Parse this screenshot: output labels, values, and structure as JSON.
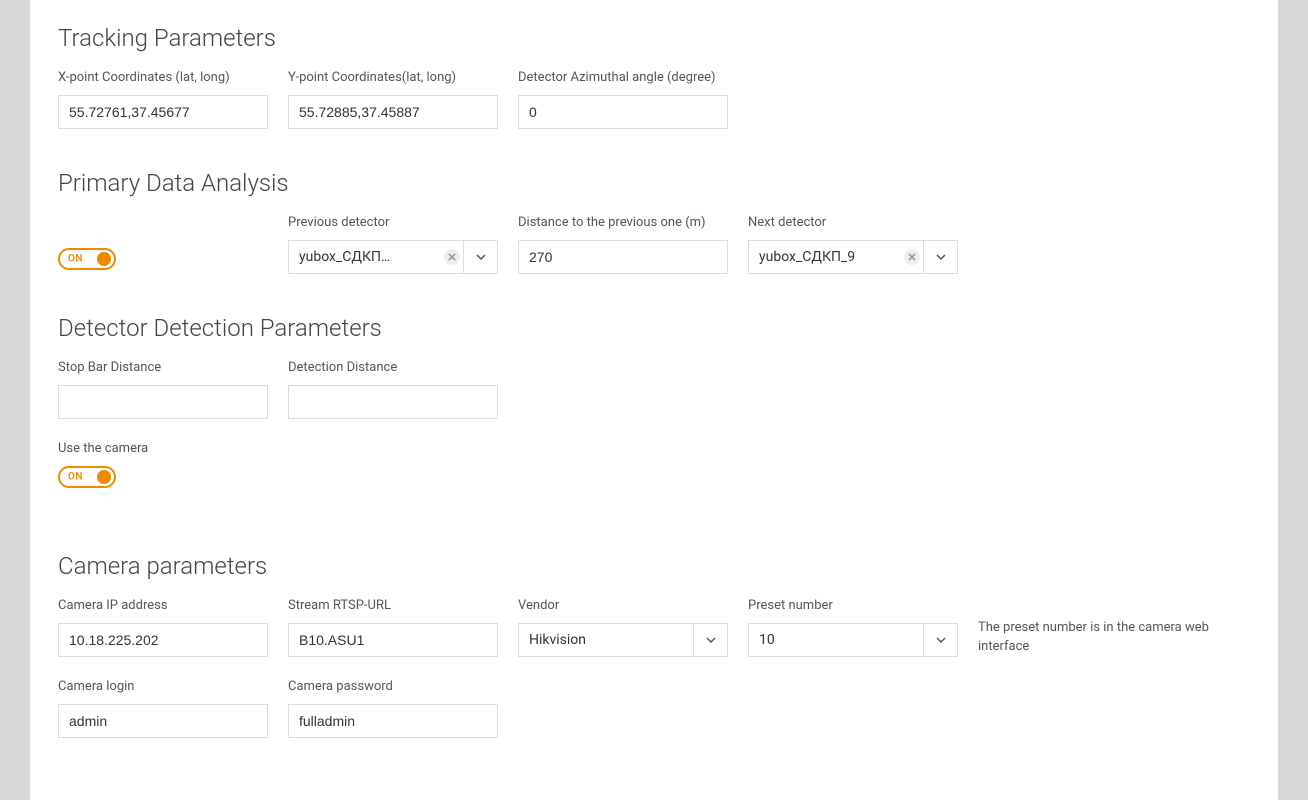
{
  "sections": {
    "tracking": {
      "title": "Tracking Parameters",
      "x_label": "X-point Coordinates (lat, long)",
      "x_value": "55.72761,37.45677",
      "y_label": "Y-point Coordinates(lat, long)",
      "y_value": "55.72885,37.45887",
      "azimuth_label": "Detector Azimuthal angle (degree)",
      "azimuth_value": "0"
    },
    "primary": {
      "title": "Primary Data Analysis",
      "toggle_label": "ON",
      "prev_label": "Previous detector",
      "prev_value": "yubox_СДКП…",
      "dist_label": "Distance to the previous one (m)",
      "dist_value": "270",
      "next_label": "Next detector",
      "next_value": "yubox_СДКП_9"
    },
    "detector": {
      "title": "Detector Detection Parameters",
      "stopbar_label": "Stop Bar Distance",
      "stopbar_value": "",
      "detdist_label": "Detection Distance",
      "detdist_value": "",
      "use_camera_label": "Use the camera",
      "use_camera_toggle": "ON"
    },
    "camera": {
      "title": "Camera parameters",
      "ip_label": "Camera IP address",
      "ip_value": "10.18.225.202",
      "rtsp_label": "Stream RTSP-URL",
      "rtsp_value": "B10.ASU1",
      "vendor_label": "Vendor",
      "vendor_value": "Hikvision",
      "preset_label": "Preset number",
      "preset_value": "10",
      "preset_hint": "The preset number is in the camera web interface",
      "login_label": "Camera login",
      "login_value": "admin",
      "pass_label": "Camera password",
      "pass_value": "fulladmin"
    }
  }
}
